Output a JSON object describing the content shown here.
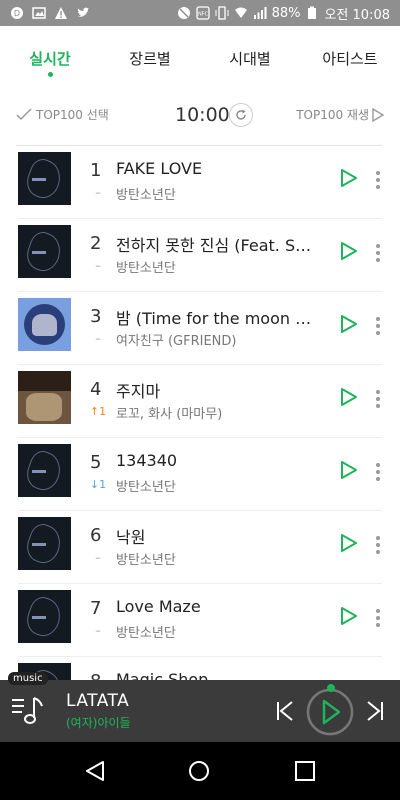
{
  "status_bar": {
    "battery": "88%",
    "time": "오전 10:08"
  },
  "tabs": [
    {
      "label": "실시간",
      "active": true
    },
    {
      "label": "장르별",
      "active": false
    },
    {
      "label": "시대별",
      "active": false
    },
    {
      "label": "아티스트",
      "active": false
    }
  ],
  "toolbar": {
    "select_label": "TOP100 선택",
    "time": "10:00",
    "play_label": "TOP100 재생"
  },
  "chart": [
    {
      "rank": "1",
      "change": "–",
      "title": "FAKE LOVE",
      "artist": "방탄소년단",
      "cover": "dark"
    },
    {
      "rank": "2",
      "change": "–",
      "title": "전하지 못한 진심 (Feat. Steve Aoki)",
      "artist": "방탄소년단",
      "cover": "dark"
    },
    {
      "rank": "3",
      "change": "–",
      "title": "밤 (Time for the moon night)",
      "artist": "여자친구 (GFRIEND)",
      "cover": "blue"
    },
    {
      "rank": "4",
      "change": "↑1",
      "title": "주지마",
      "artist": "로꼬, 화사 (마마무)",
      "cover": "brown"
    },
    {
      "rank": "5",
      "change": "↓1",
      "title": "134340",
      "artist": "방탄소년단",
      "cover": "dark"
    },
    {
      "rank": "6",
      "change": "–",
      "title": "낙원",
      "artist": "방탄소년단",
      "cover": "dark"
    },
    {
      "rank": "7",
      "change": "–",
      "title": "Love Maze",
      "artist": "방탄소년단",
      "cover": "dark"
    },
    {
      "rank": "8",
      "change": "",
      "title": "Magic Shop",
      "artist": "",
      "cover": "dark"
    }
  ],
  "player": {
    "tag": "music",
    "title": "LATATA",
    "artist": "(여자)아이들"
  },
  "colors": {
    "accent": "#1eb45a",
    "up": "#f08a24",
    "down": "#5aa0d8"
  }
}
